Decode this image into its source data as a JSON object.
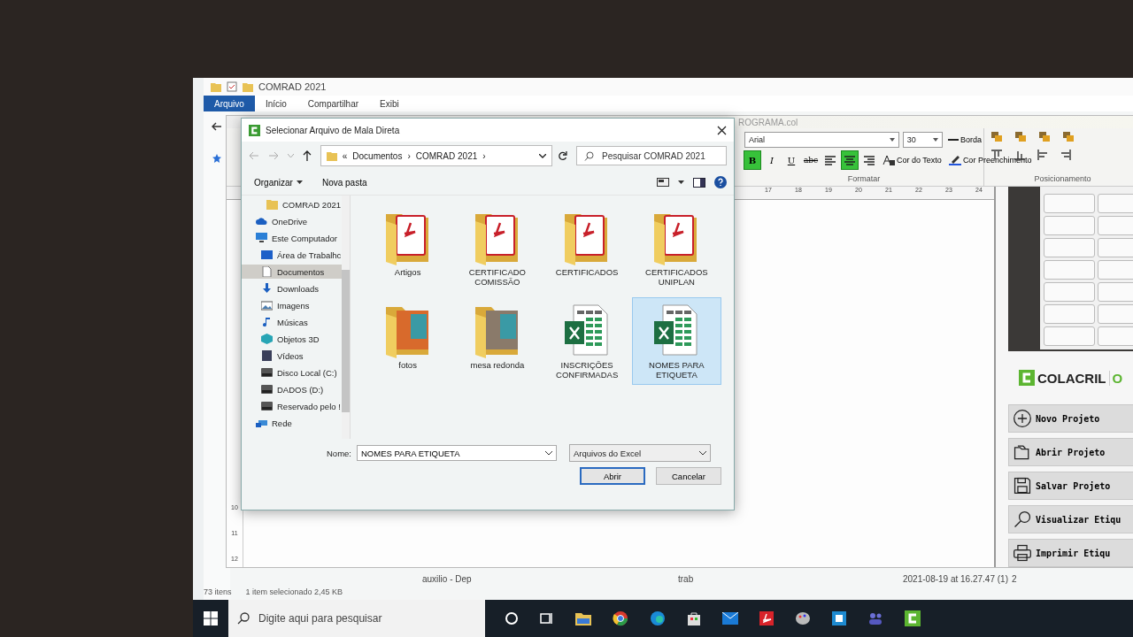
{
  "explorer": {
    "title": "COMRAD 2021",
    "ribbon_tabs": [
      {
        "label": "Arquivo",
        "selected": true
      },
      {
        "label": "Início",
        "selected": false
      },
      {
        "label": "Compartilhar",
        "selected": false
      },
      {
        "label": "Exibi",
        "selected": false
      }
    ],
    "row": [
      "auxilio - Dep",
      "trab",
      "2021-08-19 at 16.27.47 (1)",
      "2"
    ],
    "status": {
      "count": "73 itens",
      "selection": "1 item selecionado  2,45 KB"
    }
  },
  "app": {
    "title": "ROGRAMA.col",
    "font": "Arial",
    "size": "30",
    "border": "Borda",
    "format_buttons": [
      {
        "kind": "bold",
        "label": "B",
        "selected": true
      },
      {
        "kind": "italic",
        "label": "I",
        "selected": false
      },
      {
        "kind": "underline",
        "label": "U",
        "selected": false
      },
      {
        "kind": "strike",
        "label": "abc",
        "selected": false
      },
      {
        "kind": "align-left",
        "selected": false
      },
      {
        "kind": "align-center",
        "selected": true
      },
      {
        "kind": "align-right",
        "selected": false
      }
    ],
    "text_color": "Cor do Texto",
    "fill_color": "Cor Preenchimento",
    "format_group": "Formatar",
    "position_group": "Posicionamento",
    "ruler_h": [
      "17",
      "18",
      "19",
      "20",
      "21",
      "22",
      "23",
      "24"
    ],
    "ruler_v": [
      "10",
      "11",
      "12"
    ],
    "brand": "COLACRIL",
    "brand_tail": "O",
    "actions": [
      {
        "kind": "new",
        "label": "Novo Projeto"
      },
      {
        "kind": "open",
        "label": "Abrir Projeto"
      },
      {
        "kind": "save",
        "label": "Salvar Projeto"
      },
      {
        "kind": "preview",
        "label": "Visualizar Etiqu"
      },
      {
        "kind": "print",
        "label": "Imprimir Etiqu"
      }
    ]
  },
  "dialog": {
    "title": "Selecionar Arquivo de Mala Direta",
    "path": [
      "Documentos",
      "COMRAD 2021"
    ],
    "path_prefix": "«",
    "path_separator": "›",
    "search": {
      "placeholder": "Pesquisar COMRAD 2021"
    },
    "commands": [
      "Organizar",
      "Nova pasta"
    ],
    "nav": [
      {
        "label": "COMRAD 2021",
        "kind": "folder",
        "selected": false
      },
      {
        "label": "OneDrive",
        "kind": "cloud",
        "selected": false
      },
      {
        "label": "Este Computador",
        "kind": "computer",
        "selected": false,
        "children": [
          {
            "label": "Área de Trabalhc",
            "kind": "desktop",
            "selected": false
          },
          {
            "label": "Documentos",
            "kind": "document",
            "selected": true
          },
          {
            "label": "Downloads",
            "kind": "download",
            "selected": false
          },
          {
            "label": "Imagens",
            "kind": "image",
            "selected": false
          },
          {
            "label": "Músicas",
            "kind": "music",
            "selected": false
          },
          {
            "label": "Objetos 3D",
            "kind": "cube",
            "selected": false
          },
          {
            "label": "Vídeos",
            "kind": "video",
            "selected": false
          },
          {
            "label": "Disco Local (C:)",
            "kind": "drive",
            "selected": false
          },
          {
            "label": "DADOS (D:)",
            "kind": "drive",
            "selected": false
          },
          {
            "label": "Reservado pelo !",
            "kind": "drive",
            "selected": false
          }
        ]
      },
      {
        "label": "Rede",
        "kind": "network",
        "selected": false
      }
    ],
    "files": [
      {
        "name": "Artigos",
        "kind": "pdf-folder",
        "selected": false
      },
      {
        "name": "CERTIFICADO COMISSÃO",
        "kind": "pdf-folder",
        "selected": false
      },
      {
        "name": "CERTIFICADOS",
        "kind": "pdf-folder",
        "selected": false
      },
      {
        "name": "CERTIFICADOS UNIPLAN",
        "kind": "pdf-folder",
        "selected": false
      },
      {
        "name": "fotos",
        "kind": "photo-folder",
        "selected": false
      },
      {
        "name": "mesa redonda",
        "kind": "photo-folder",
        "selected": false
      },
      {
        "name": "INSCRIÇÕES CONFIRMADAS",
        "kind": "excel",
        "selected": false
      },
      {
        "name": "NOMES PARA ETIQUETA",
        "kind": "excel",
        "selected": true
      }
    ],
    "name_label": "Nome:",
    "name_value": "NOMES PARA ETIQUETA",
    "filter": "Arquivos do Excel",
    "buttons": [
      "Abrir",
      "Cancelar"
    ]
  },
  "taskbar": {
    "search": {
      "placeholder": "Digite aqui para pesquisar"
    }
  }
}
